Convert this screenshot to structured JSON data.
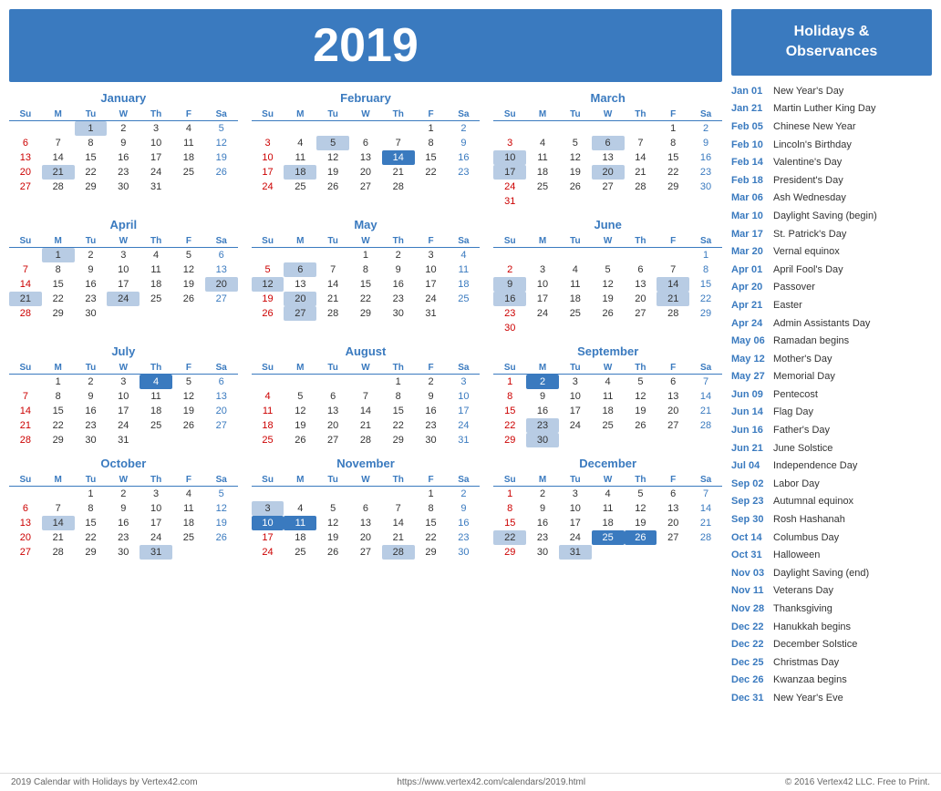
{
  "year": "2019",
  "months": [
    {
      "name": "January",
      "startDay": 2,
      "days": 31,
      "highlighted": [
        1,
        21
      ],
      "darkHighlight": []
    },
    {
      "name": "February",
      "startDay": 5,
      "days": 28,
      "highlighted": [
        5,
        12,
        18
      ],
      "darkHighlight": [
        14
      ]
    },
    {
      "name": "March",
      "startDay": 5,
      "days": 31,
      "highlighted": [
        6,
        10,
        17,
        20
      ],
      "darkHighlight": []
    },
    {
      "name": "April",
      "startDay": 1,
      "days": 30,
      "highlighted": [
        1,
        20,
        21,
        24
      ],
      "darkHighlight": []
    },
    {
      "name": "May",
      "startDay": 3,
      "days": 31,
      "highlighted": [
        6,
        12,
        20,
        27
      ],
      "darkHighlight": []
    },
    {
      "name": "June",
      "startDay": 6,
      "days": 30,
      "highlighted": [
        9,
        14,
        16,
        21
      ],
      "darkHighlight": []
    },
    {
      "name": "July",
      "startDay": 1,
      "days": 31,
      "highlighted": [
        4
      ],
      "darkHighlight": []
    },
    {
      "name": "August",
      "startDay": 4,
      "days": 31,
      "highlighted": [],
      "darkHighlight": []
    },
    {
      "name": "September",
      "startDay": 0,
      "days": 30,
      "highlighted": [
        2,
        23,
        30
      ],
      "darkHighlight": []
    },
    {
      "name": "October",
      "startDay": 2,
      "days": 31,
      "highlighted": [
        14,
        31
      ],
      "darkHighlight": []
    },
    {
      "name": "November",
      "startDay": 5,
      "days": 30,
      "highlighted": [
        3,
        11,
        28
      ],
      "darkHighlight": [
        10
      ]
    },
    {
      "name": "December",
      "startDay": 0,
      "days": 31,
      "highlighted": [
        22,
        25,
        26,
        31
      ],
      "darkHighlight": [
        24,
        25,
        26
      ]
    }
  ],
  "sidebar": {
    "title": "Holidays &\nObservances",
    "holidays": [
      {
        "date": "Jan 01",
        "name": "New Year's Day"
      },
      {
        "date": "Jan 21",
        "name": "Martin Luther King Day"
      },
      {
        "date": "Feb 05",
        "name": "Chinese New Year"
      },
      {
        "date": "Feb 10",
        "name": "Lincoln's Birthday"
      },
      {
        "date": "Feb 14",
        "name": "Valentine's Day"
      },
      {
        "date": "Feb 18",
        "name": "President's Day"
      },
      {
        "date": "Mar 06",
        "name": "Ash Wednesday"
      },
      {
        "date": "Mar 10",
        "name": "Daylight Saving (begin)"
      },
      {
        "date": "Mar 17",
        "name": "St. Patrick's Day"
      },
      {
        "date": "Mar 20",
        "name": "Vernal equinox"
      },
      {
        "date": "Apr 01",
        "name": "April Fool's Day"
      },
      {
        "date": "Apr 20",
        "name": "Passover"
      },
      {
        "date": "Apr 21",
        "name": "Easter"
      },
      {
        "date": "Apr 24",
        "name": "Admin Assistants Day"
      },
      {
        "date": "May 06",
        "name": "Ramadan begins"
      },
      {
        "date": "May 12",
        "name": "Mother's Day"
      },
      {
        "date": "May 27",
        "name": "Memorial Day"
      },
      {
        "date": "Jun 09",
        "name": "Pentecost"
      },
      {
        "date": "Jun 14",
        "name": "Flag Day"
      },
      {
        "date": "Jun 16",
        "name": "Father's Day"
      },
      {
        "date": "Jun 21",
        "name": "June Solstice"
      },
      {
        "date": "Jul 04",
        "name": "Independence Day"
      },
      {
        "date": "Sep 02",
        "name": "Labor Day"
      },
      {
        "date": "Sep 23",
        "name": "Autumnal equinox"
      },
      {
        "date": "Sep 30",
        "name": "Rosh Hashanah"
      },
      {
        "date": "Oct 14",
        "name": "Columbus Day"
      },
      {
        "date": "Oct 31",
        "name": "Halloween"
      },
      {
        "date": "Nov 03",
        "name": "Daylight Saving (end)"
      },
      {
        "date": "Nov 11",
        "name": "Veterans Day"
      },
      {
        "date": "Nov 28",
        "name": "Thanksgiving"
      },
      {
        "date": "Dec 22",
        "name": "Hanukkah begins"
      },
      {
        "date": "Dec 22",
        "name": "December Solstice"
      },
      {
        "date": "Dec 25",
        "name": "Christmas Day"
      },
      {
        "date": "Dec 26",
        "name": "Kwanzaa begins"
      },
      {
        "date": "Dec 31",
        "name": "New Year's Eve"
      }
    ]
  },
  "footer": {
    "left": "2019 Calendar with Holidays by Vertex42.com",
    "center": "https://www.vertex42.com/calendars/2019.html",
    "right": "© 2016 Vertex42 LLC. Free to Print."
  }
}
